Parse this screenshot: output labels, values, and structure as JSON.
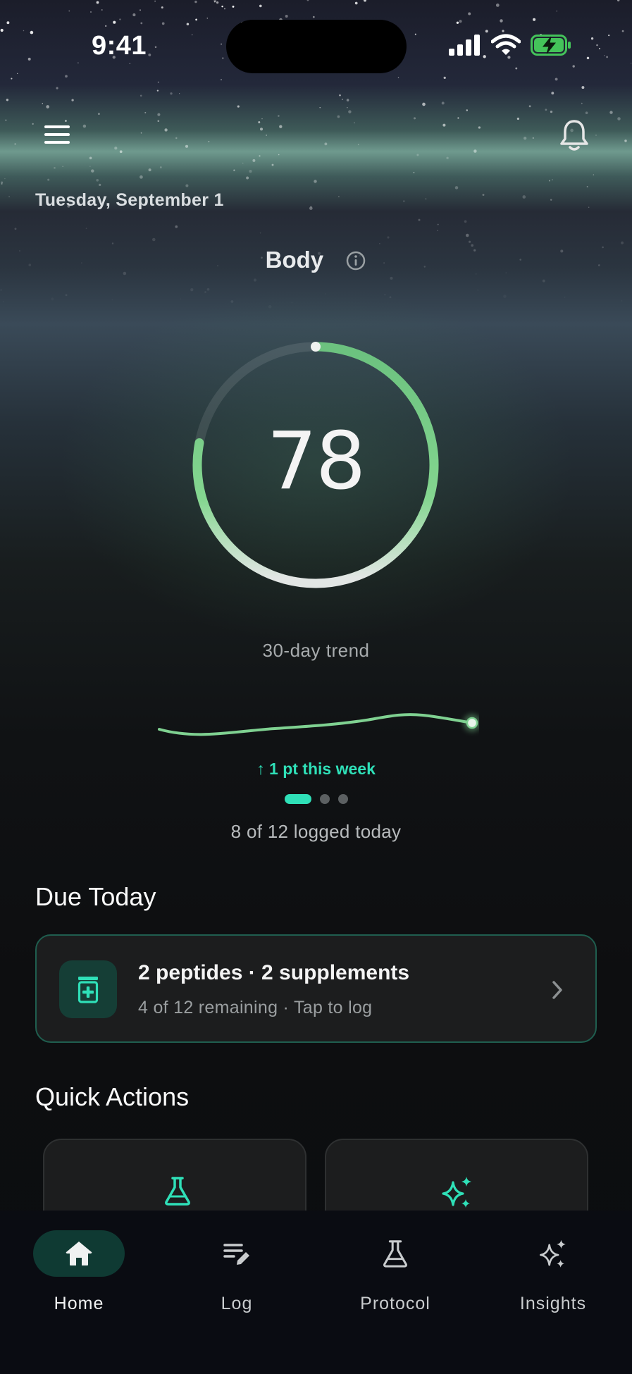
{
  "status_bar": {
    "time": "9:41"
  },
  "header": {
    "date": "Tuesday, September 1",
    "title": "Body"
  },
  "score": {
    "value": "78",
    "progress": 0.78
  },
  "trend": {
    "label": "30-day trend",
    "delta": "↑ 1 pt this week",
    "logged": "8 of 12 logged today",
    "page_index": 0,
    "page_count": 3
  },
  "due_today": {
    "title": "Due Today",
    "main": "2 peptides · 2 supplements",
    "sub": "4 of 12 remaining · Tap to log"
  },
  "quick_actions": {
    "title": "Quick Actions",
    "items": [
      {
        "icon": "flask-icon"
      },
      {
        "icon": "sparkles-icon"
      }
    ]
  },
  "tabbar": {
    "tabs": [
      {
        "label": "Home",
        "icon": "home-icon",
        "active": true
      },
      {
        "label": "Log",
        "icon": "log-edit-icon",
        "active": false
      },
      {
        "label": "Protocol",
        "icon": "flask-icon",
        "active": false
      },
      {
        "label": "Insights",
        "icon": "sparkles-icon",
        "active": false
      }
    ]
  },
  "colors": {
    "accent": "#2fe0b8",
    "gauge_green": "#7fd191",
    "card_border": "#1f5e4f"
  }
}
